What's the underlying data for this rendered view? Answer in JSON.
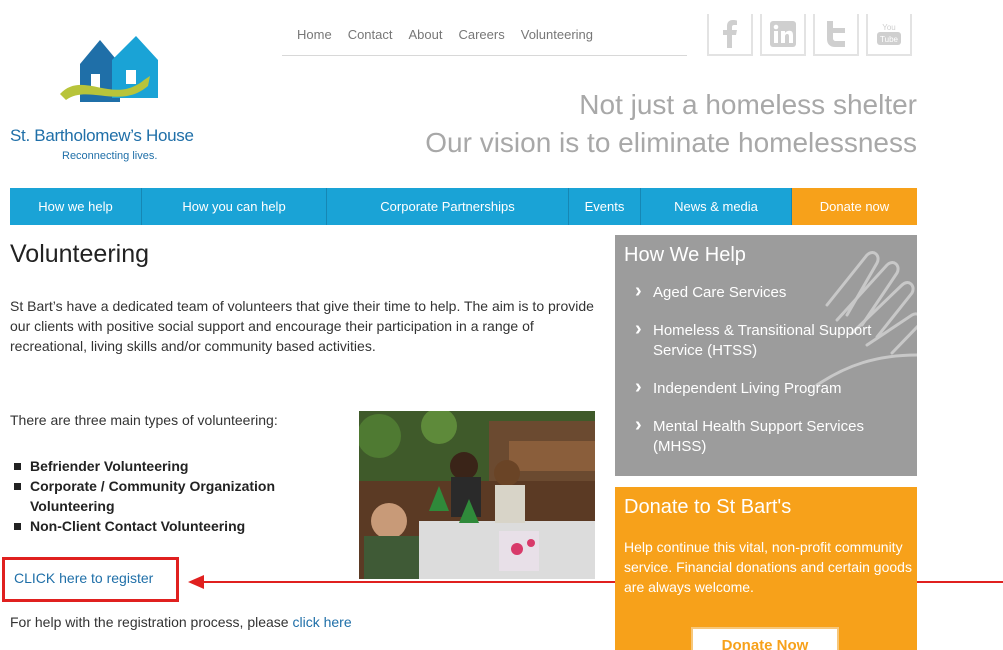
{
  "brand": {
    "name": "St. Bartholomew’s House",
    "tagline": "Reconnecting lives.",
    "colors": {
      "blue": "#1aa3d6",
      "logo_blue": "#1f6fa8",
      "orange": "#f7a11a",
      "grey": "#9c9c9c",
      "lime": "#b8c43a"
    }
  },
  "topnav": {
    "items": [
      {
        "label": "Home"
      },
      {
        "label": "Contact"
      },
      {
        "label": "About"
      },
      {
        "label": "Careers"
      },
      {
        "label": "Volunteering"
      }
    ]
  },
  "social": {
    "icons": [
      "facebook-icon",
      "linkedin-icon",
      "twitter-icon",
      "youtube-icon"
    ],
    "youtube_top": "You",
    "youtube_bottom": "Tube"
  },
  "header": {
    "line1": "Not just a homeless shelter",
    "line2": "Our vision is to eliminate homelessness"
  },
  "mainnav": {
    "items": [
      {
        "label": "How we help"
      },
      {
        "label": "How you can help"
      },
      {
        "label": "Corporate Partnerships"
      },
      {
        "label": "Events"
      },
      {
        "label": "News & media"
      },
      {
        "label": "Donate now"
      }
    ]
  },
  "content": {
    "title": "Volunteering",
    "intro": "St Bart’s have a dedicated team of volunteers that give their time to help. The aim is to provide our clients with positive social support and encourage their participation in a range of recreational, living skills and/or community based activities.",
    "types_heading": "There are three main types of volunteering:",
    "types": [
      "Befriender Volunteering",
      "Corporate / Community Organization Volunteering",
      "Non-Client Contact Volunteering"
    ],
    "register_link": "CLICK here to register",
    "help_text": "For help with the registration process, please",
    "help_link": "click here"
  },
  "sidebar": {
    "help_title": "How We Help",
    "help_items": [
      "Aged Care Services",
      "Homeless & Transitional Support Service (HTSS)",
      "Independent Living Program",
      "Mental Health Support Services (MHSS)"
    ],
    "donate_title": "Donate to St Bart's",
    "donate_text": "Help continue this vital, non-profit community service. Financial donations and certain goods are always welcome.",
    "donate_button": "Donate Now"
  }
}
